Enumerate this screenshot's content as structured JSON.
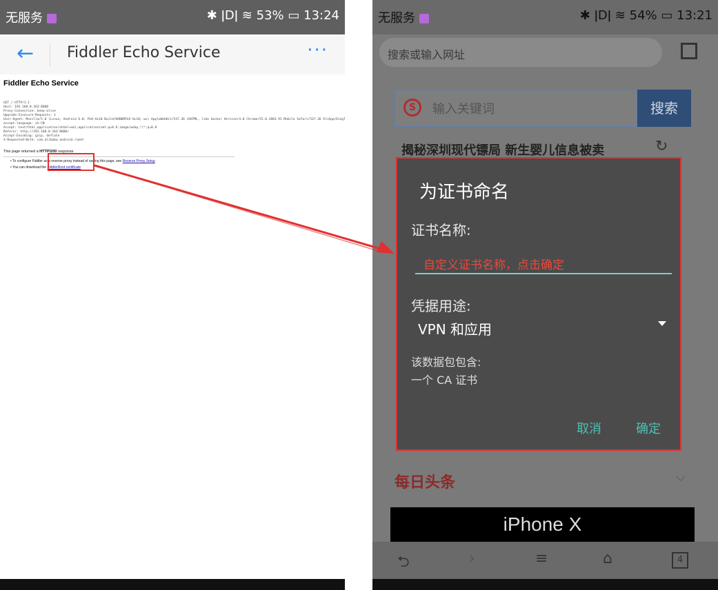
{
  "left": {
    "status": {
      "carrier": "无服务",
      "battery": "53%",
      "time": "13:24",
      "icons": "✱ ǀDǀ ≋"
    },
    "appbar": {
      "title": "Fiddler Echo Service",
      "back": "←",
      "more": "···"
    },
    "doc": {
      "heading": "Fiddler Echo Service",
      "request_lines": [
        "GET / HTTP/1.1",
        "Host: 192.168.0.163:8888",
        "Proxy-Connection: keep-alive",
        "Upgrade-Insecure-Requests: 1",
        "User-Agent: Mozilla/5.0 (Linux; Android 6.0; PLK-AL10 Build/HONORPLK-AL10; wv) AppleWebKit/537.36 (KHTML, like Gecko) Version/4.0 Chrome/55.0.2883.91 Mobile Safari/537.36 AliApp(DingTalk",
        "accept-language: zh-CN",
        "Accept: text/html,application/xhtml+xml,application/xml;q=0.9,image/webp,*/*;q=0.8",
        "Referer: http://192.168.0.163:8888/",
        "Accept-Encoding: gzip, deflate",
        "X-Requested-With: com.alibaba.android.rimet"
      ],
      "response_prefix": "This page returned a ",
      "response_code": "HTTP/200",
      "response_suffix": " response",
      "item1_prefix": "To configure Fiddler as a reverse proxy instead of seeing this page, see ",
      "item1_link": "Reverse Proxy Setup",
      "item2_prefix": "You can download the ",
      "item2_link": "FiddlerRoot certificate"
    }
  },
  "right": {
    "status": {
      "carrier": "无服务",
      "battery": "54%",
      "time": "13:21",
      "icons": "✱ ǀDǀ ≋"
    },
    "url_placeholder": "搜索或输入网址",
    "search_placeholder": "输入关键词",
    "search_button": "搜索",
    "search_logo": "S",
    "news_headline": "揭秘深圳现代镖局   新生婴儿信息被卖",
    "dialog": {
      "title": "为证书命名",
      "name_label": "证书名称:",
      "name_value": "自定义证书名称，点击确定",
      "usage_label": "凭据用途:",
      "usage_value": "VPN 和应用",
      "contains_label": "该数据包包含:",
      "contains_value": "一个 CA 证书",
      "cancel": "取消",
      "ok": "确定"
    },
    "toutiao": "每日头条",
    "banner": "iPhone X",
    "bottom_icons": {
      "back": "⮌",
      "forward": "›",
      "menu": "≡",
      "home": "⌂",
      "tabs": "4"
    }
  },
  "colors": {
    "accent_red": "#e03030",
    "teal": "#4fc0b4",
    "link_blue": "#2f8cf0"
  }
}
